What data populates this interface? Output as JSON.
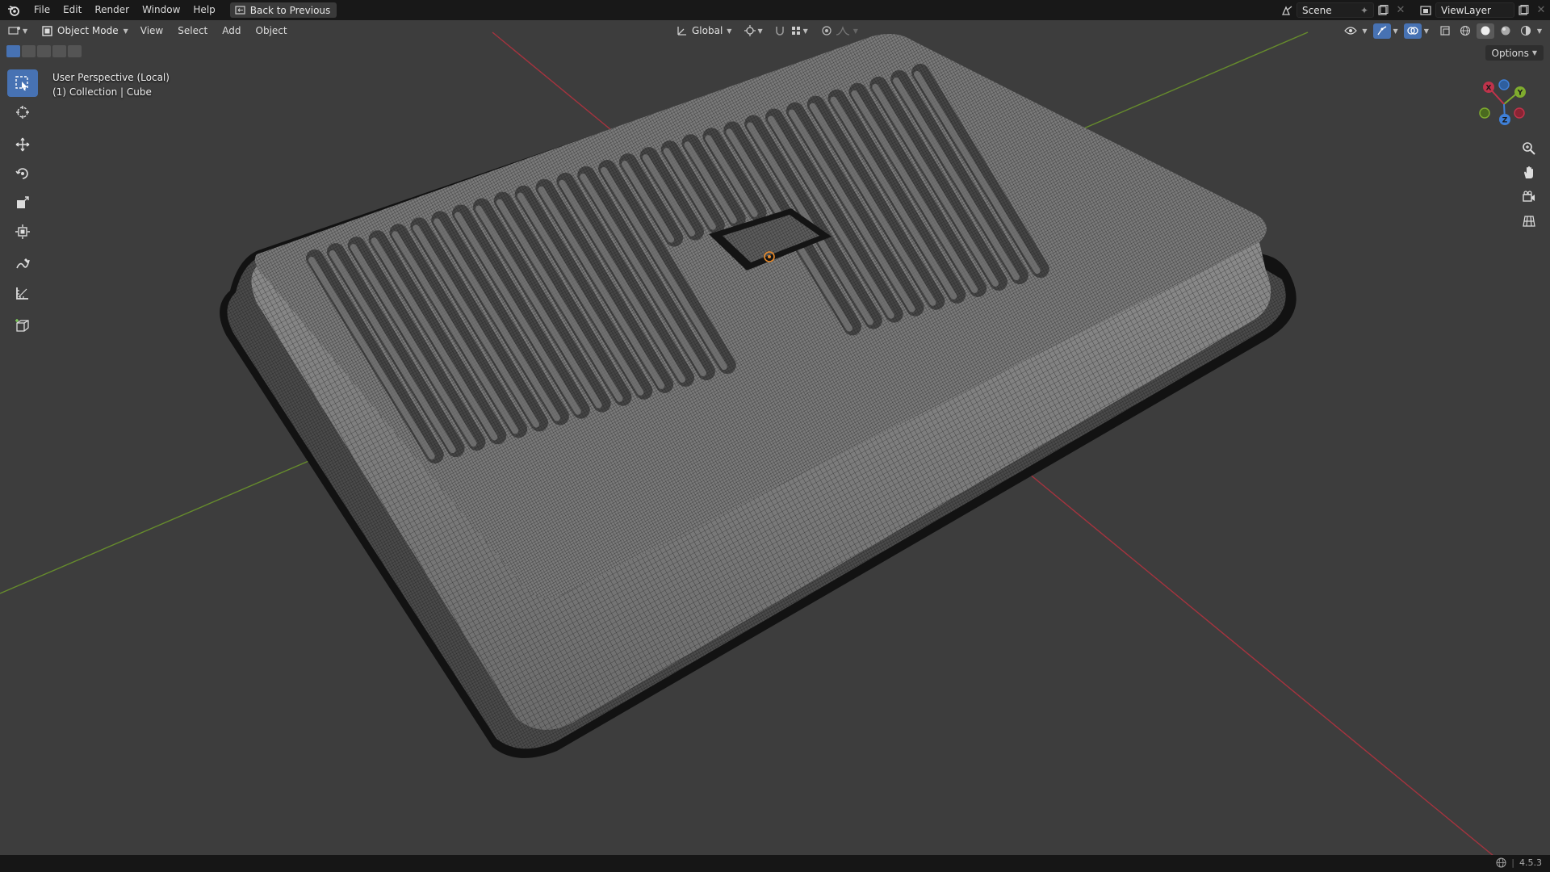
{
  "topbar": {
    "logo_icon": "blender-logo-icon",
    "menus": [
      "File",
      "Edit",
      "Render",
      "Window",
      "Help"
    ],
    "back_button_label": "Back to Previous",
    "scene_name": "Scene",
    "view_layer_name": "ViewLayer"
  },
  "header": {
    "editor_type_icon": "viewport-editor-icon",
    "mode": "Object Mode",
    "menus": [
      "View",
      "Select",
      "Add",
      "Object"
    ],
    "transform_orientation": "Global",
    "options_label": "Options"
  },
  "toolbar": {
    "tools": [
      "select-box-icon",
      "cursor-icon",
      "move-icon",
      "rotate-icon",
      "scale-icon",
      "transform-icon",
      "annotate-icon",
      "measure-icon",
      "add-cube-icon"
    ]
  },
  "viewport": {
    "perspective_label": "User Perspective (Local)",
    "collection_label": "(1) Collection | Cube",
    "axis_colors": {
      "x": "#c0334b",
      "y": "#7fac2e",
      "z": "#3f80d8"
    },
    "gizmo_labels": {
      "x": "X",
      "y": "Y",
      "z": "Z"
    }
  },
  "status": {
    "version": "4.5.3"
  },
  "colors": {
    "accent": "#4772b3",
    "background": "#3d3d3d",
    "topbar": "#181818"
  }
}
